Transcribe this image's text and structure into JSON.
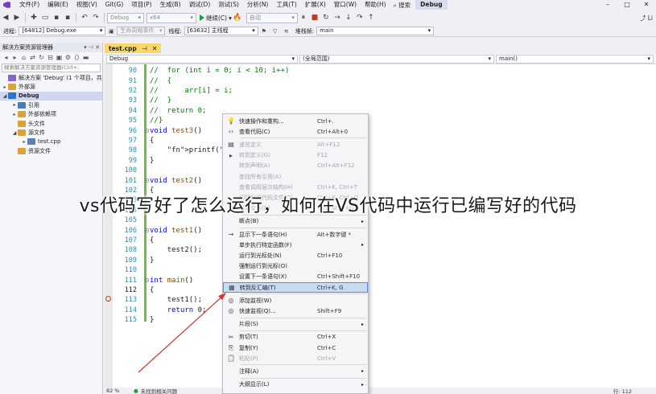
{
  "menubar": {
    "items": [
      "文件(F)",
      "编辑(E)",
      "视图(V)",
      "Git(G)",
      "项目(P)",
      "生成(B)",
      "调试(D)",
      "测试(S)",
      "分析(N)",
      "工具(T)",
      "扩展(X)",
      "窗口(W)",
      "帮助(H)"
    ],
    "search": "搜索",
    "solution": "Debug",
    "live_share": "Li"
  },
  "toolbar": {
    "config": "Debug",
    "platform": "x64",
    "run_label": "继续(C)",
    "auto_combo": "自动"
  },
  "debugbar": {
    "process_label": "进程:",
    "process_value": "[64812] Debug.exe",
    "lifecycle_label": "生命周期事件",
    "thread_label": "线程:",
    "thread_value": "[63632] 主线程",
    "stack_label": "堆栈帧:",
    "stack_value": "main"
  },
  "solution_explorer": {
    "title": "解决方案资源管理器",
    "search_placeholder": "搜索解决方案资源管理器(Ctrl+;",
    "tree": [
      {
        "label": "解决方案 'Debug' (1 个项目，共",
        "icon": "solution-icon",
        "indent": 0,
        "exp": ""
      },
      {
        "label": "外部源",
        "icon": "folder-icon",
        "indent": 0,
        "exp": "▸"
      },
      {
        "label": "Debug",
        "icon": "project-icon",
        "indent": 0,
        "exp": "◢",
        "selected": true
      },
      {
        "label": "引用",
        "icon": "reference-icon",
        "indent": 1,
        "exp": "▸"
      },
      {
        "label": "外部依赖项",
        "icon": "folder-icon",
        "indent": 1,
        "exp": "▸"
      },
      {
        "label": "头文件",
        "icon": "folder-icon",
        "indent": 1,
        "exp": ""
      },
      {
        "label": "源文件",
        "icon": "folder-icon",
        "indent": 1,
        "exp": "◢"
      },
      {
        "label": "test.cpp",
        "icon": "cpp-file-icon",
        "indent": 2,
        "exp": "▸"
      },
      {
        "label": "资源文件",
        "icon": "folder-icon",
        "indent": 1,
        "exp": ""
      }
    ]
  },
  "editor": {
    "tab_label": "test.cpp",
    "nav_project": "Debug",
    "nav_scope": "(全局范围)",
    "nav_function": "main()",
    "lines": [
      {
        "n": "90",
        "fold": "",
        "text": "//  for (int i = 0; i < 10; i++)",
        "kind": "comment"
      },
      {
        "n": "91",
        "fold": "",
        "text": "//  {",
        "kind": "comment"
      },
      {
        "n": "92",
        "fold": "",
        "text": "//      arr[i] = i;",
        "kind": "comment"
      },
      {
        "n": "93",
        "fold": "",
        "text": "//  }",
        "kind": "comment"
      },
      {
        "n": "94",
        "fold": "",
        "text": "//  return 0;",
        "kind": "comment"
      },
      {
        "n": "95",
        "fold": "",
        "text": "//}",
        "kind": "comment"
      },
      {
        "n": "96",
        "fold": "⊟",
        "text": "void test3()",
        "kind": "func"
      },
      {
        "n": "97",
        "fold": "",
        "text": "{",
        "kind": "plain"
      },
      {
        "n": "98",
        "fold": "",
        "text": "    printf(\"hehe",
        "kind": "printf"
      },
      {
        "n": "99",
        "fold": "",
        "text": "}",
        "kind": "plain"
      },
      {
        "n": "100",
        "fold": "",
        "text": "",
        "kind": "plain"
      },
      {
        "n": "101",
        "fold": "⊟",
        "text": "void test2()",
        "kind": "func"
      },
      {
        "n": "102",
        "fold": "",
        "text": "{",
        "kind": "plain"
      },
      {
        "n": "103",
        "fold": "",
        "text": "",
        "kind": "plain"
      },
      {
        "n": "104",
        "fold": "",
        "text": "",
        "kind": "plain"
      },
      {
        "n": "105",
        "fold": "",
        "text": "",
        "kind": "plain"
      },
      {
        "n": "106",
        "fold": "⊟",
        "text": "void test1()",
        "kind": "func"
      },
      {
        "n": "107",
        "fold": "",
        "text": "{",
        "kind": "plain"
      },
      {
        "n": "108",
        "fold": "",
        "text": "    test2();",
        "kind": "plain"
      },
      {
        "n": "109",
        "fold": "",
        "text": "}",
        "kind": "plain"
      },
      {
        "n": "110",
        "fold": "",
        "text": "",
        "kind": "plain"
      },
      {
        "n": "111",
        "fold": "⊟",
        "text": "int main()",
        "kind": "func"
      },
      {
        "n": "112",
        "fold": "",
        "text": "{",
        "kind": "plain"
      },
      {
        "n": "113",
        "fold": "",
        "text": "    test1();",
        "kind": "plain"
      },
      {
        "n": "114",
        "fold": "",
        "text": "    return 0;",
        "kind": "return"
      },
      {
        "n": "115",
        "fold": "",
        "text": "}",
        "kind": "plain"
      }
    ]
  },
  "context_menu": {
    "items": [
      {
        "icon": "lightbulb-icon",
        "glyph": "💡",
        "label": "快速操作和重构...",
        "shortcut": "Ctrl+.",
        "disabled": false,
        "arrow": ""
      },
      {
        "icon": "code-icon",
        "glyph": "‹›",
        "label": "查看代码(C)",
        "shortcut": "Ctrl+Alt+0",
        "disabled": false,
        "arrow": ""
      },
      {
        "sep": true
      },
      {
        "icon": "peek-icon",
        "glyph": "▤",
        "label": "速览定义",
        "shortcut": "Alt+F12",
        "disabled": true,
        "arrow": ""
      },
      {
        "icon": "goto-def-icon",
        "glyph": "▸",
        "label": "转到定义(G)",
        "shortcut": "F12",
        "disabled": true,
        "arrow": ""
      },
      {
        "icon": "goto-decl-icon",
        "glyph": "",
        "label": "转到声明(A)",
        "shortcut": "Ctrl+Alt+F12",
        "disabled": true,
        "arrow": ""
      },
      {
        "icon": "",
        "glyph": "",
        "label": "查找所有引用(A)",
        "shortcut": "",
        "disabled": true,
        "arrow": ""
      },
      {
        "icon": "",
        "glyph": "",
        "label": "查看调用层次结构(H)",
        "shortcut": "Ctrl+K, Ctrl+T",
        "disabled": true,
        "arrow": ""
      },
      {
        "icon": "",
        "glyph": "",
        "label": "切换标题代码文件(O)",
        "shortcut": "Ctrl+K, Ctrl+O",
        "disabled": true,
        "arrow": ""
      },
      {
        "icon": "",
        "glyph": "",
        "label": "转到文档(D)",
        "shortcut": "Ctrl+Shift+G",
        "disabled": true,
        "arrow": ""
      },
      {
        "sep": true
      },
      {
        "icon": "",
        "glyph": "",
        "label": "断点(B)",
        "shortcut": "",
        "disabled": false,
        "arrow": "▸"
      },
      {
        "sep": true
      },
      {
        "icon": "arrow-right-icon",
        "glyph": "→",
        "label": "显示下一条语句(H)",
        "shortcut": "Alt+数字键 *",
        "disabled": false,
        "arrow": ""
      },
      {
        "icon": "",
        "glyph": "",
        "label": "单步执行特定函数(F)",
        "shortcut": "",
        "disabled": false,
        "arrow": "▸"
      },
      {
        "icon": "",
        "glyph": "",
        "label": "运行到光标处(N)",
        "shortcut": "Ctrl+F10",
        "disabled": false,
        "arrow": ""
      },
      {
        "icon": "",
        "glyph": "",
        "label": "强制运行到光标(O)",
        "shortcut": "",
        "disabled": false,
        "arrow": ""
      },
      {
        "icon": "",
        "glyph": "",
        "label": "设置下一条语句(X)",
        "shortcut": "Ctrl+Shift+F10",
        "disabled": false,
        "arrow": ""
      },
      {
        "icon": "disassembly-icon",
        "glyph": "▦",
        "label": "转到反汇编(T)",
        "shortcut": "Ctrl+K, G",
        "disabled": false,
        "arrow": "",
        "highlight": true
      },
      {
        "sep": true
      },
      {
        "icon": "watch-icon",
        "glyph": "◎",
        "label": "添加监视(W)",
        "shortcut": "",
        "disabled": false,
        "arrow": ""
      },
      {
        "icon": "quickwatch-icon",
        "glyph": "◎",
        "label": "快速监视(Q)...",
        "shortcut": "Shift+F9",
        "disabled": false,
        "arrow": ""
      },
      {
        "sep": true
      },
      {
        "icon": "",
        "glyph": "",
        "label": "片段(S)",
        "shortcut": "",
        "disabled": false,
        "arrow": "▸"
      },
      {
        "sep": true
      },
      {
        "icon": "cut-icon",
        "glyph": "✂",
        "label": "剪切(T)",
        "shortcut": "Ctrl+X",
        "disabled": false,
        "arrow": ""
      },
      {
        "icon": "copy-icon",
        "glyph": "⎘",
        "label": "复制(Y)",
        "shortcut": "Ctrl+C",
        "disabled": false,
        "arrow": ""
      },
      {
        "icon": "paste-icon",
        "glyph": "📋",
        "label": "粘贴(P)",
        "shortcut": "Ctrl+V",
        "disabled": true,
        "arrow": ""
      },
      {
        "sep": true
      },
      {
        "icon": "",
        "glyph": "",
        "label": "注释(A)",
        "shortcut": "",
        "disabled": false,
        "arrow": "▸"
      },
      {
        "sep": true
      },
      {
        "icon": "",
        "glyph": "",
        "label": "大纲显示(L)",
        "shortcut": "",
        "disabled": false,
        "arrow": "▸"
      }
    ]
  },
  "statusbar": {
    "zoom": "82 %",
    "issues": "未找到相关问题",
    "position": "行: 112"
  },
  "caption": "vs代码写好了怎么运行，如何在VS代码中运行已编写好的代码",
  "colors": {
    "menu_bg": "#eef0f6",
    "tab_active": "#f9d869",
    "comment": "#008000",
    "keyword": "#0000ff",
    "string": "#a31515",
    "line_number": "#2b91af",
    "highlight": "#c9daf3",
    "annotation_arrow": "#d9342b"
  }
}
